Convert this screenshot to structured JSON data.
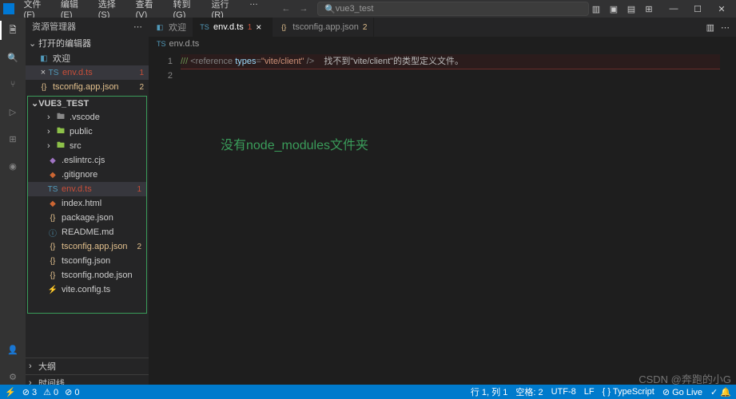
{
  "menu": {
    "file": "文件(F)",
    "edit": "编辑(E)",
    "select": "选择(S)",
    "view": "查看(V)",
    "goto": "转到(G)",
    "run": "运行(R)",
    "more": "…"
  },
  "search_placeholder": "vue3_test",
  "sidebar": {
    "title": "资源管理器",
    "open_editors": "打开的编辑器",
    "items": [
      {
        "label": "欢迎"
      },
      {
        "label": "env.d.ts",
        "badge": "1"
      },
      {
        "label": "tsconfig.app.json",
        "badge": "2"
      }
    ],
    "project": "VUE3_TEST",
    "files": [
      {
        "label": ".vscode",
        "type": "folder"
      },
      {
        "label": "public",
        "type": "folder"
      },
      {
        "label": "src",
        "type": "folder"
      },
      {
        "label": ".eslintrc.cjs",
        "type": "file"
      },
      {
        "label": ".gitignore",
        "type": "file"
      },
      {
        "label": "env.d.ts",
        "type": "file",
        "err": "1"
      },
      {
        "label": "index.html",
        "type": "file"
      },
      {
        "label": "package.json",
        "type": "file"
      },
      {
        "label": "README.md",
        "type": "file"
      },
      {
        "label": "tsconfig.app.json",
        "type": "file",
        "warn": "2"
      },
      {
        "label": "tsconfig.json",
        "type": "file"
      },
      {
        "label": "tsconfig.node.json",
        "type": "file"
      },
      {
        "label": "vite.config.ts",
        "type": "file"
      }
    ],
    "outline": "大纲",
    "timeline": "时间线"
  },
  "tabs": [
    {
      "label": "欢迎",
      "icon": "vs"
    },
    {
      "label": "env.d.ts",
      "icon": "ts",
      "badge": "1",
      "active": true
    },
    {
      "label": "tsconfig.app.json",
      "icon": "json",
      "badge": "2"
    }
  ],
  "breadcrumb": {
    "icon": "TS",
    "file": "env.d.ts"
  },
  "code": {
    "line_nums": [
      "1",
      "2"
    ],
    "l1_a": "/// ",
    "l1_b": "<reference ",
    "l1_c": "types",
    "l1_d": "=",
    "l1_e": "\"vite/client\"",
    "l1_f": " />",
    "l1_err": "    找不到\"vite/client\"的类型定义文件。"
  },
  "annotation": "没有node_modules文件夹",
  "status": {
    "remote": "⚡",
    "errors": "⊘ 3",
    "warnings": "⚠ 0",
    "port": "⊘ 0",
    "ln": "行 1, 列 1",
    "spaces": "空格: 2",
    "enc": "UTF-8",
    "eol": "LF",
    "lang": "{ } TypeScript",
    "golive": "⊘ Go Live",
    "bell": "✓  🔔"
  },
  "watermark": "CSDN @奔跑的小G"
}
